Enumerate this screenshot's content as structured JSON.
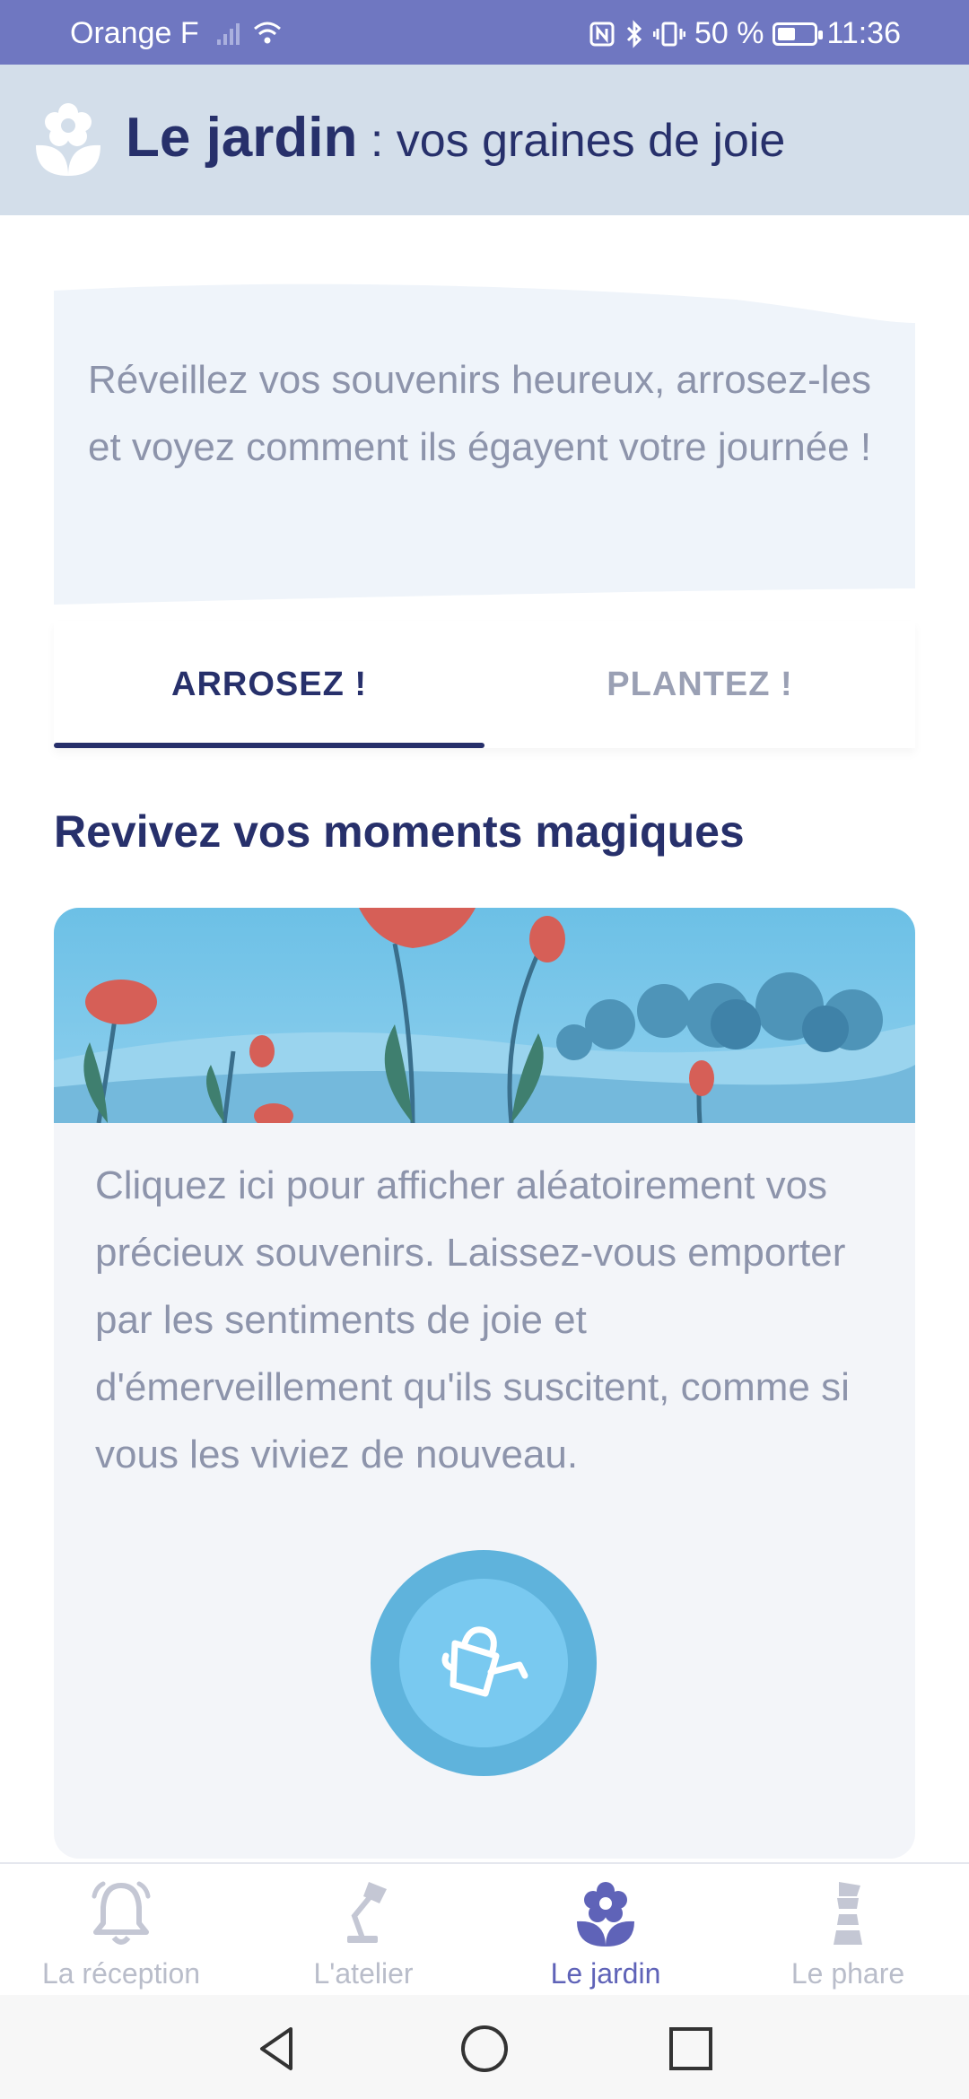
{
  "status_bar": {
    "carrier": "Orange F",
    "battery": "50 %",
    "time": "11:36",
    "battery_level": 0.5
  },
  "header": {
    "title": "Le jardin",
    "subtitle": " : vos graines de joie",
    "icon": "flower-icon"
  },
  "intro": {
    "text": "Réveillez vos souvenirs heureux, arrosez-les et voyez comment ils égayent votre journée !"
  },
  "tabs": [
    {
      "label": "ARROSEZ !",
      "active": true
    },
    {
      "label": "PLANTEZ !",
      "active": false
    }
  ],
  "section": {
    "title": "Revivez vos moments magiques"
  },
  "card": {
    "text": "Cliquez ici pour afficher aléatoirement vos précieux souvenirs. Laissez-vous emporter par les sentiments de joie et d'émerveillement qu'ils suscitent, comme si vous les viviez de nouveau.",
    "button_icon": "watering-can-icon"
  },
  "bottom_nav": [
    {
      "label": "La réception",
      "icon": "bell-icon",
      "active": false
    },
    {
      "label": "L'atelier",
      "icon": "desk-lamp-icon",
      "active": false
    },
    {
      "label": "Le jardin",
      "icon": "flower-icon",
      "active": true
    },
    {
      "label": "Le phare",
      "icon": "lighthouse-icon",
      "active": false
    }
  ],
  "colors": {
    "status_bar": "#6f77c1",
    "header_bg": "#d3deea",
    "primary": "#27306b",
    "accent_nav": "#5f63b8",
    "button": "#5fb3dc"
  }
}
